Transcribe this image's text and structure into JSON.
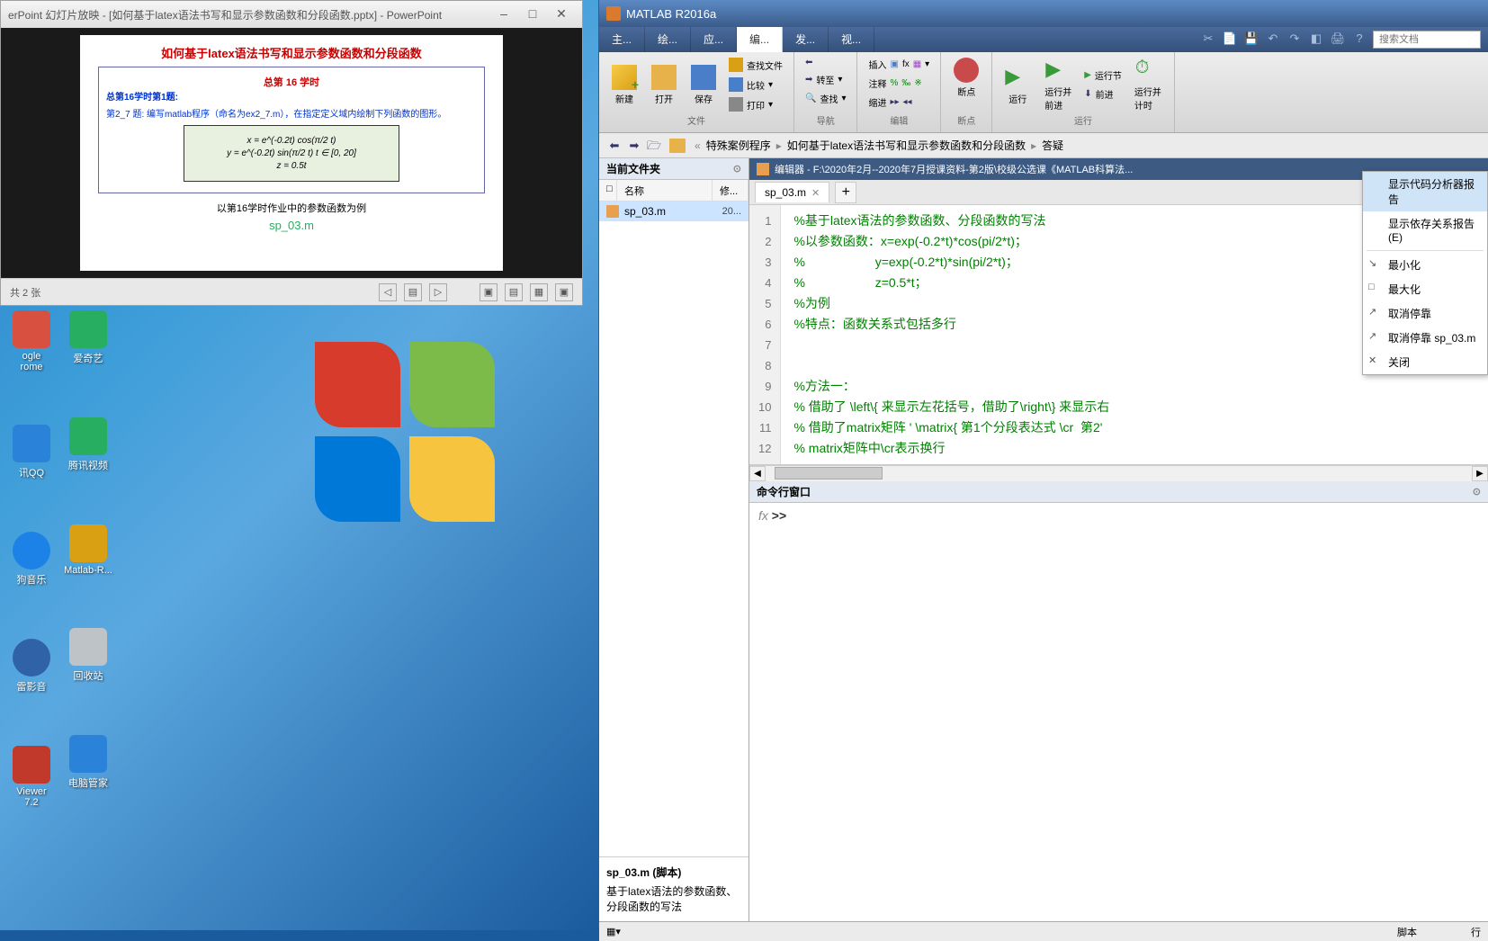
{
  "desktop": {
    "icons_col1": [
      {
        "label": "ogle",
        "label2": "rome",
        "color": "#d85040"
      },
      {
        "label": "讯QQ",
        "label2": "",
        "color": "#2b82d9"
      },
      {
        "label": "狗音乐",
        "label2": "",
        "color": "#1d82e8"
      },
      {
        "label": "雷影音",
        "label2": "",
        "color": "#3062a8"
      },
      {
        "label": "Viewer",
        "label2": "7.2",
        "color": "#c0392b"
      }
    ],
    "icons_col2": [
      {
        "label": "爱奇艺",
        "color": "#27ae60"
      },
      {
        "label": "腾讯视频",
        "color": "#27ae60"
      },
      {
        "label": "Matlab-R...",
        "color": "#d9a014"
      },
      {
        "label": "回收站",
        "color": "#bdc3c7"
      },
      {
        "label": "电脑管家",
        "color": "#2b82d9"
      }
    ]
  },
  "ppt": {
    "title": "erPoint 幻灯片放映 - [如何基于latex语法书写和显示参数函数和分段函数.pptx] - PowerPoint",
    "slide_title": "如何基于latex语法书写和显示参数函数和分段函数",
    "slide_subtitle": "总第 16 学时",
    "slide_header": "总第16学时第1题:",
    "slide_content": "第2_7 题: 编写matlab程序（命名为ex2_7.m），在指定定义域内绘制下列函数的图形。",
    "math_line1": "x = e^(-0.2t) cos(π/2 t)",
    "math_line2": "y = e^(-0.2t) sin(π/2 t)     t ∈ [0, 20]",
    "math_line3": "z = 0.5t",
    "slide_caption": "以第16学时作业中的参数函数为例",
    "slide_file": "sp_03.m",
    "status_left": "共 2 张"
  },
  "matlab": {
    "title": "MATLAB R2016a",
    "tabs": [
      "主...",
      "绘...",
      "应...",
      "编...",
      "发...",
      "视..."
    ],
    "active_tab": 3,
    "search_placeholder": "搜索文档",
    "toolstrip": {
      "new": "新建",
      "open": "打开",
      "save": "保存",
      "find_files": "查找文件",
      "compare": "比较",
      "print": "打印",
      "file_sec": "文件",
      "go": "转至",
      "find": "查找",
      "nav_sec": "导航",
      "insert": "插入",
      "comment": "注释",
      "indent": "缩进",
      "edit_sec": "编辑",
      "breakpoint": "断点",
      "bp_sec": "断点",
      "run": "运行",
      "run_advance": "运行并\n前进",
      "run_section": "运行节",
      "advance": "前进",
      "run_time": "运行并\n计时",
      "run_sec": "运行"
    },
    "addr": {
      "crumbs": [
        "特殊案例程序",
        "如何基于latex语法书写和显示参数函数和分段函数",
        "答疑"
      ]
    },
    "cf": {
      "title": "当前文件夹",
      "col_name": "名称",
      "col_date": "修...",
      "item_name": "sp_03.m",
      "item_date": "20...",
      "desc_title": "sp_03.m  (脚本)",
      "desc_text": "基于latex语法的参数函数、分段函数的写法"
    },
    "editor": {
      "header": "编辑器 - F:\\2020年2月--2020年7月授课资料-第2版\\校级公选课《MATLAB科算法...",
      "tab_name": "sp_03.m",
      "lines": [
        "%基于latex语法的参数函数、分段函数的写法",
        "%以参数函数：x=exp(-0.2*t)*cos(pi/2*t)；",
        "%                    y=exp(-0.2*t)*sin(pi/2*t)；",
        "%                    z=0.5*t；",
        "%为例",
        "%特点：函数关系式包括多行",
        "",
        "",
        "%方法一：",
        "% 借助了 \\left\\{ 来显示左花括号，借助了\\right\\} 来显示右",
        "% 借助了matrix矩阵 ' \\matrix{ 第1个分段表达式 \\cr  第2'",
        "% matrix矩阵中\\cr表示换行"
      ]
    },
    "cmd": {
      "title": "命令行窗口",
      "prompt_fx": "fx",
      "prompt": ">>"
    },
    "status_right": "脚本",
    "status_far": "行"
  },
  "ctx_menu": {
    "items": [
      {
        "label": "显示代码分析器报告",
        "hover": true
      },
      {
        "label": "显示依存关系报告(E)"
      },
      {
        "sep": true
      },
      {
        "label": "最小化",
        "icon": "↘"
      },
      {
        "label": "最大化",
        "icon": "□"
      },
      {
        "label": "取消停靠",
        "icon": "↗"
      },
      {
        "label": "取消停靠 sp_03.m",
        "icon": "↗"
      },
      {
        "label": "关闭",
        "icon": "✕"
      }
    ]
  }
}
